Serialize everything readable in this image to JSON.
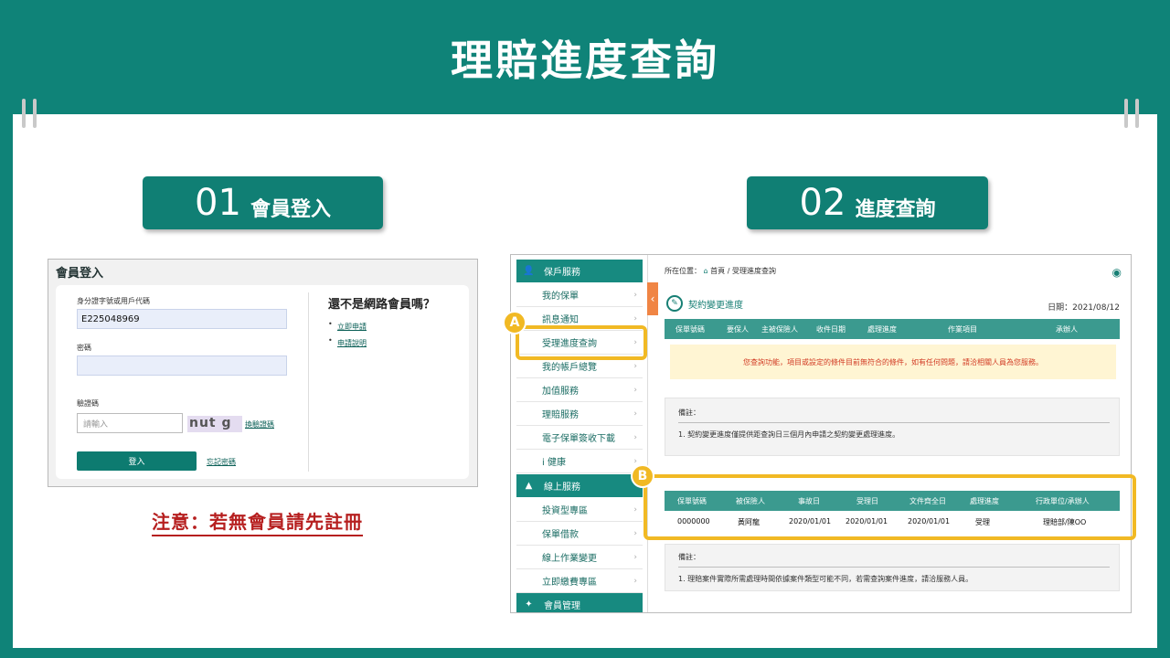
{
  "title": "理賠進度查詢",
  "steps": [
    {
      "num": "01",
      "text": "會員登入"
    },
    {
      "num": "02",
      "text": "進度查詢"
    }
  ],
  "login": {
    "title": "會員登入",
    "id_label": "身分證字號或用戶代碼",
    "id_value": "E225048969",
    "password_label": "密碼",
    "captcha_label": "驗證碼",
    "captcha_placeholder": "請輸入",
    "captcha_text": "nut g",
    "refresh_captcha": "換驗證碼",
    "login_button": "登入",
    "forgot_password": "忘記密碼",
    "not_member_title": "還不是網路會員嗎？",
    "apply_now": "立即申請",
    "apply_info": "申請說明"
  },
  "note": "注意：若無會員請先註冊",
  "sidebar": {
    "groups": [
      {
        "title": "保戶服務",
        "icon": "user-icon"
      },
      {
        "title": "線上服務",
        "icon": "chart-icon"
      },
      {
        "title": "會員管理",
        "icon": "share-icon"
      }
    ],
    "items": [
      "我的保單",
      "訊息通知",
      "受理進度查詢",
      "我的帳戶總覽",
      "加值服務",
      "理賠服務",
      "電子保單簽收下載",
      "i 健康"
    ],
    "items2": [
      "投資型專區",
      "保單借款",
      "線上作業變更",
      "立即繳費專區"
    ]
  },
  "main": {
    "breadcrumb_label": "所在位置：",
    "breadcrumb_home": "首頁",
    "breadcrumb_sep": "/",
    "breadcrumb_current": "受理進度查詢",
    "section_title": "契約變更進度",
    "date_label": "日期：2021/08/12",
    "contract_headers": [
      "保單號碼",
      "要保人",
      "主被保險人",
      "收件日期",
      "處理進度",
      "作業項目",
      "承辦人"
    ],
    "warning": "您查詢功能，項目或設定的條件目前無符合的條件，如有任何問題，請洽相關人員為您服務。",
    "remark_title": "備註：",
    "remark1": "1.   契約變更進度僅提供距查詢日三個月內申請之契約變更處理進度。",
    "claim_headers": [
      "保單號碼",
      "被保險人",
      "事故日",
      "受理日",
      "文件齊全日",
      "處理進度",
      "行政單位/承辦人"
    ],
    "claim_row": [
      "0000000",
      "黃阿龍",
      "2020/01/01",
      "2020/01/01",
      "2020/01/01",
      "受理",
      "理賠部/陳OO"
    ],
    "remark2_title": "備註：",
    "remark2": "1.   理賠案件實際所需處理時間依據案件類型可能不同，若需查詢案件進度，請洽服務人員。"
  },
  "tags": {
    "a": "A",
    "b": "B"
  },
  "colors": {
    "background": "#0f8378",
    "accent": "#107f74",
    "highlight": "#f1b924",
    "warning_text": "#d23b24"
  }
}
